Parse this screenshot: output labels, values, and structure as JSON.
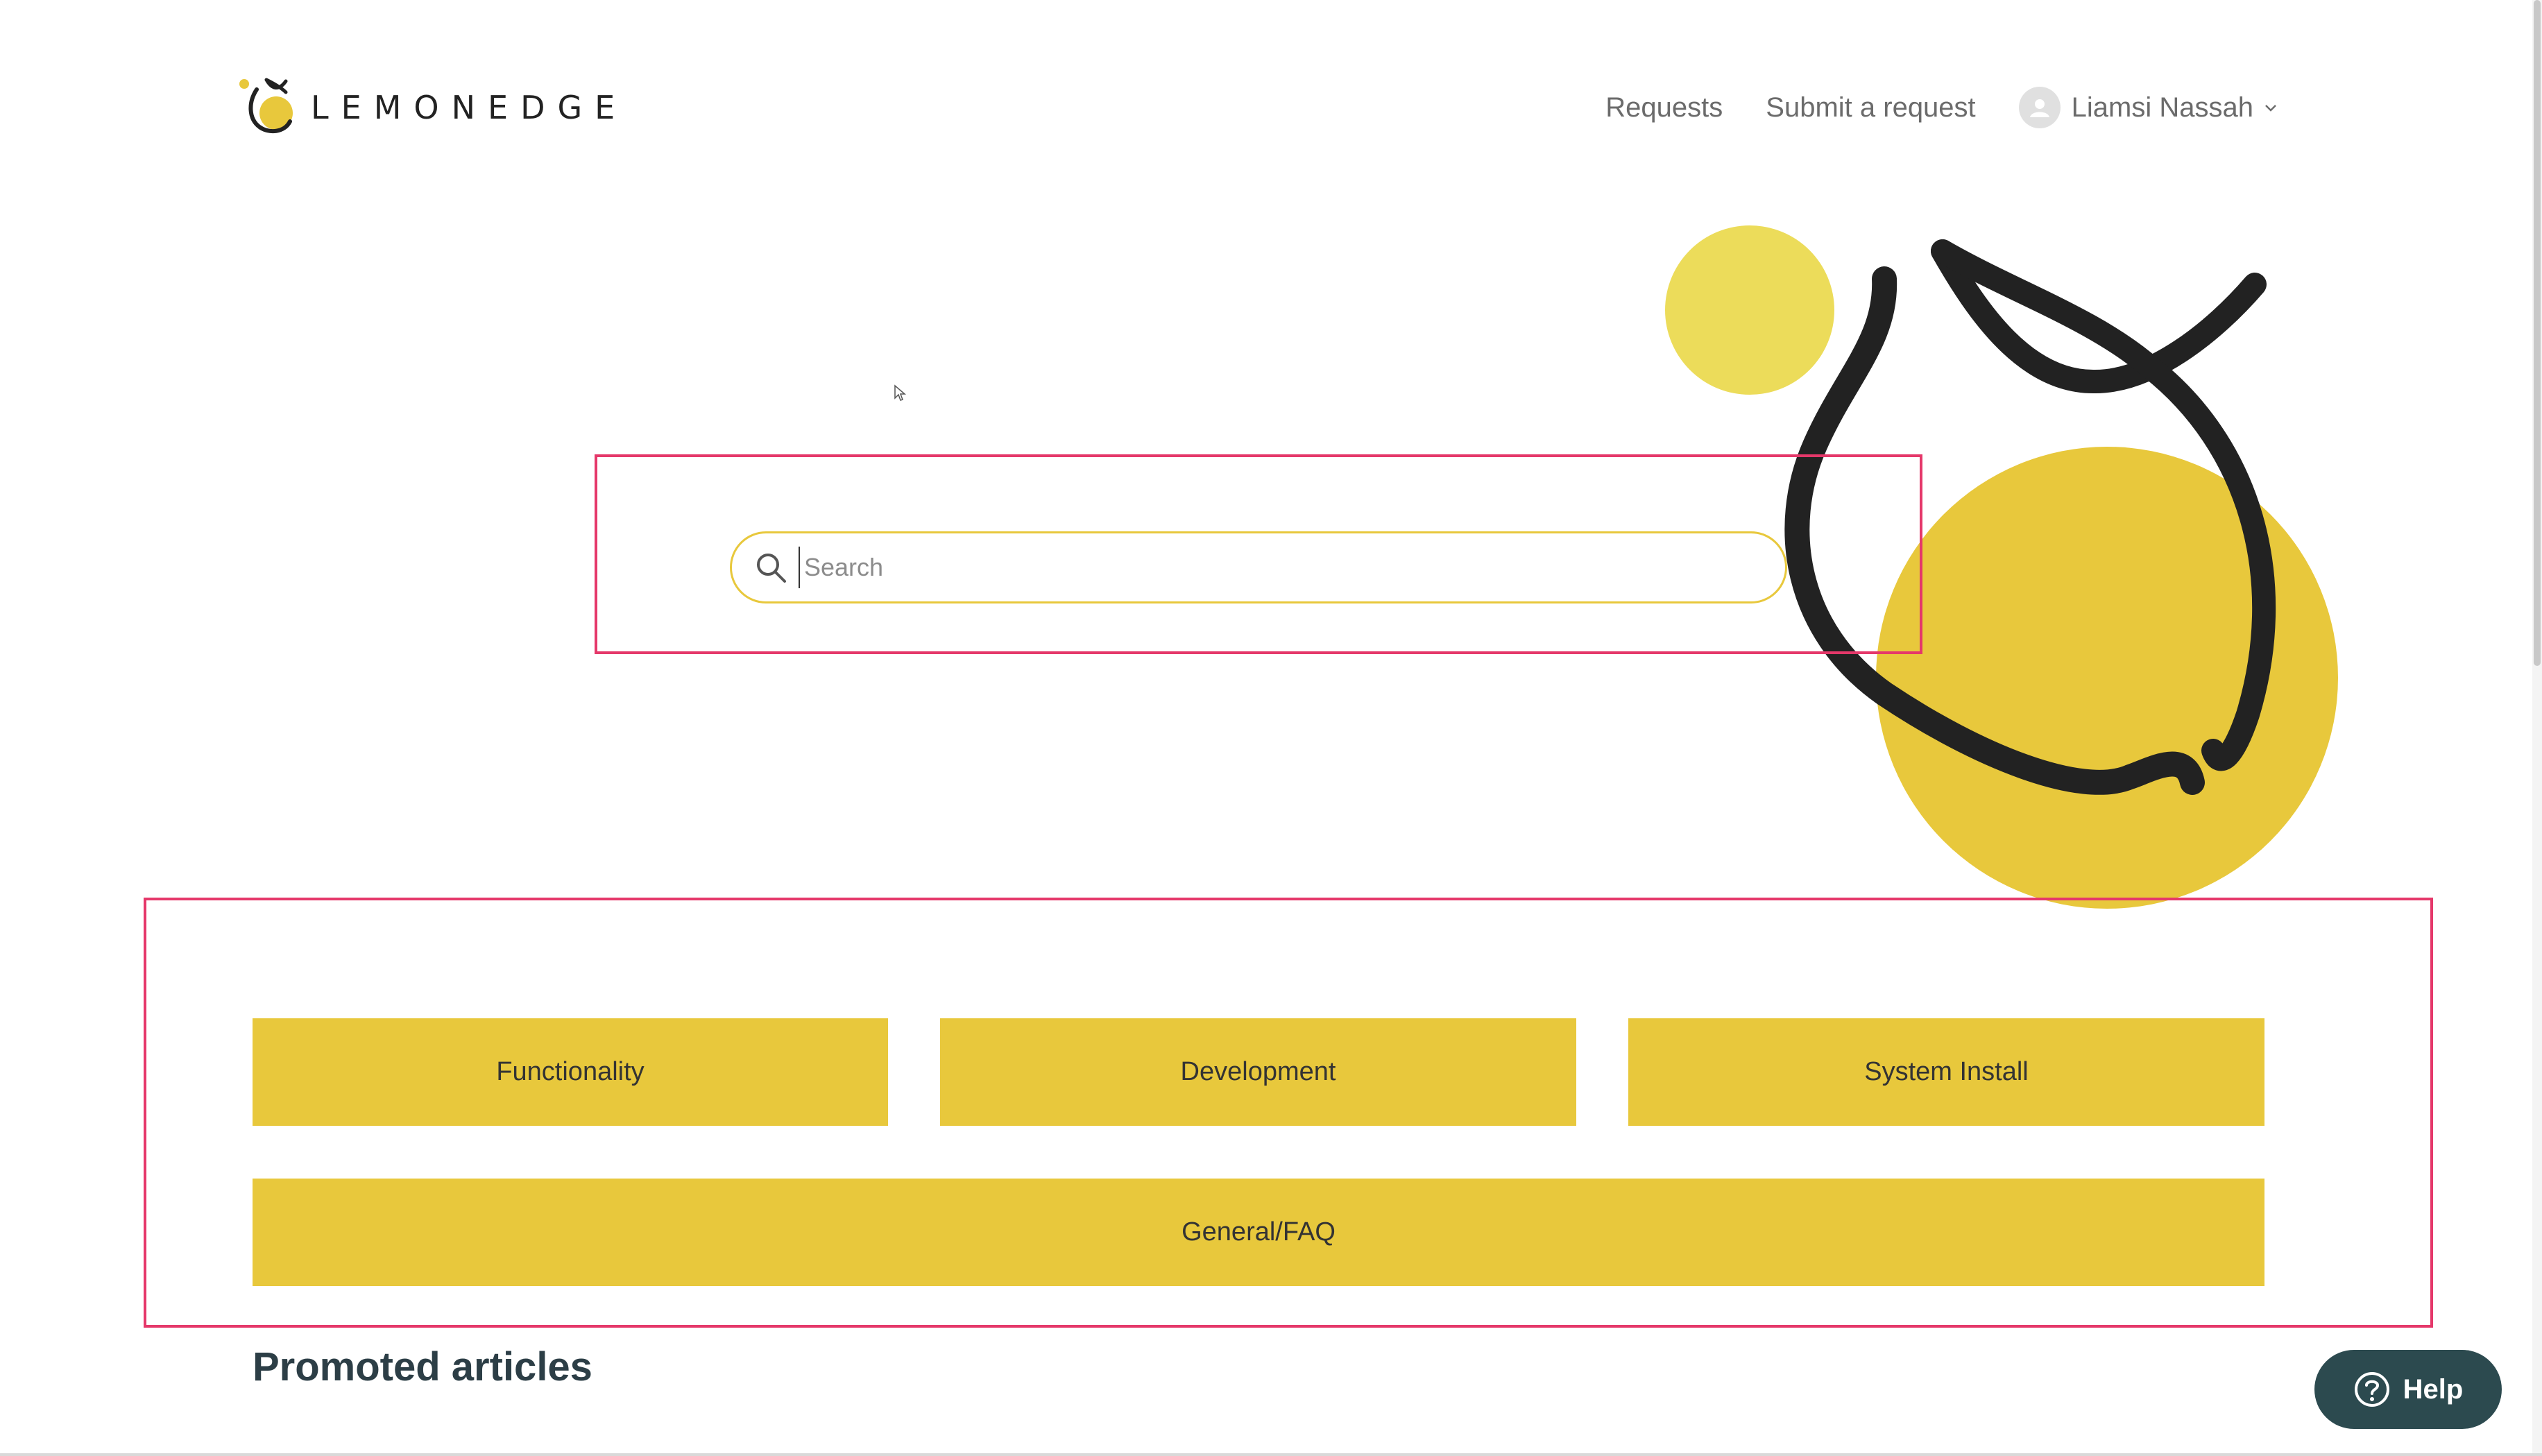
{
  "header": {
    "logo_text": "LEMONEDGE",
    "nav": {
      "requests": "Requests",
      "submit_request": "Submit a request",
      "user_name": "Liamsi Nassah"
    }
  },
  "search": {
    "placeholder": "Search",
    "value": ""
  },
  "categories": [
    {
      "label": "Functionality"
    },
    {
      "label": "Development"
    },
    {
      "label": "System Install"
    },
    {
      "label": "General/FAQ"
    }
  ],
  "promoted": {
    "heading": "Promoted articles"
  },
  "help_widget": {
    "label": "Help"
  },
  "colors": {
    "brand_yellow": "#e8c83c",
    "light_yellow": "#ecdc5a",
    "highlight_border": "#e5386a",
    "help_bg": "#2c4a4f",
    "heading": "#2c3e46"
  },
  "icons": {
    "logo": "lemon-logo-icon",
    "avatar": "user-avatar-icon",
    "menu": "chevron-down-icon",
    "search": "search-icon",
    "help": "question-circle-icon",
    "hero": "lemon-illustration"
  }
}
